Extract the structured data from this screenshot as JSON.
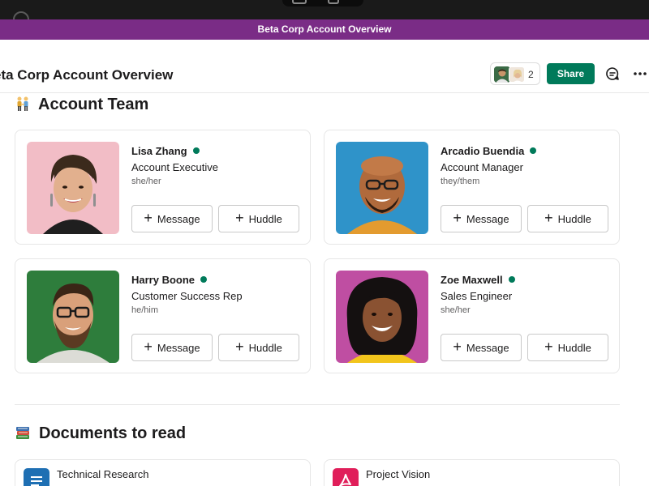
{
  "title_bar": {
    "text": "Beta Corp Account Overview"
  },
  "header": {
    "page_title": "eta Corp Account Overview",
    "member_count": "2",
    "share_label": "Share"
  },
  "sections": {
    "team_title": "Account Team",
    "docs_title": "Documents to read"
  },
  "team": [
    {
      "name": "Lisa Zhang",
      "role": "Account Executive",
      "pronouns": "she/her",
      "message_label": "Message",
      "huddle_label": "Huddle"
    },
    {
      "name": "Arcadio Buendia",
      "role": "Account Manager",
      "pronouns": "they/them",
      "message_label": "Message",
      "huddle_label": "Huddle"
    },
    {
      "name": "Harry Boone",
      "role": "Customer Success Rep",
      "pronouns": "he/him",
      "message_label": "Message",
      "huddle_label": "Huddle"
    },
    {
      "name": "Zoe Maxwell",
      "role": "Sales Engineer",
      "pronouns": "she/her",
      "message_label": "Message",
      "huddle_label": "Huddle"
    }
  ],
  "documents": [
    {
      "title": "Technical Research",
      "icon": "doc-icon",
      "color": "#1e6fb3"
    },
    {
      "title": "Project Vision",
      "icon": "pdf-icon",
      "color": "#e01e5a"
    }
  ],
  "colors": {
    "title_bar": "#7a2c86",
    "share": "#007a5a",
    "presence": "#007a5a"
  }
}
